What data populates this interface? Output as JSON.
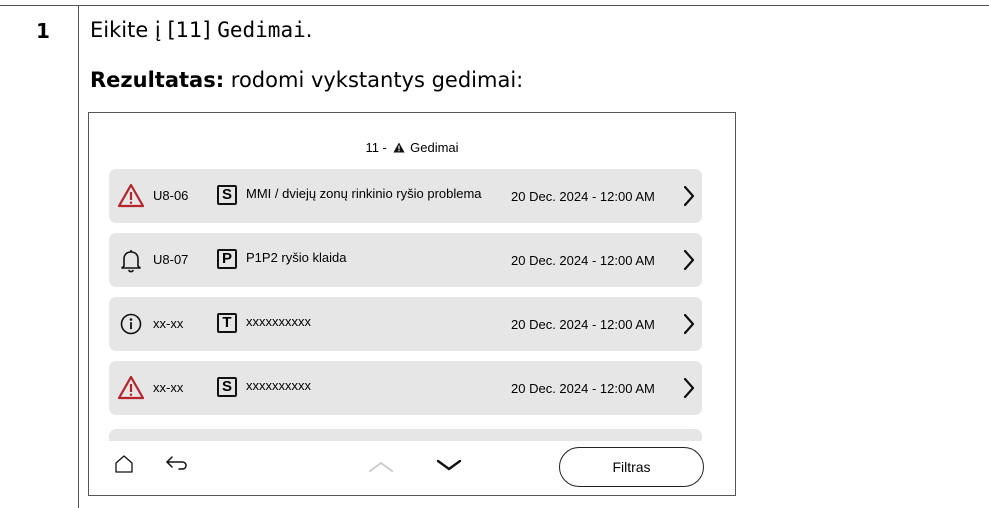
{
  "step": {
    "number": "1",
    "instruction_pre": "Eikite į [11] ",
    "instruction_code": "Gedimai",
    "instruction_post": ".",
    "result_label": "Rezultatas:",
    "result_text": " rodomi vykstantys gedimai:"
  },
  "screen": {
    "title_number": "11 -",
    "title_text": "Gedimai",
    "rows": [
      {
        "severity": "warning-icon",
        "code": "U8-06",
        "category": "S",
        "description": "MMI / dviejų zonų rinkinio ryšio problema",
        "datetime": "20 Dec. 2024 - 12:00 AM"
      },
      {
        "severity": "bell-icon",
        "code": "U8-07",
        "category": "P",
        "description": "P1P2 ryšio klaida",
        "datetime": "20 Dec. 2024 - 12:00 AM"
      },
      {
        "severity": "info-icon",
        "code": "xx-xx",
        "category": "T",
        "description": "xxxxxxxxxx",
        "datetime": "20 Dec. 2024 - 12:00 AM"
      },
      {
        "severity": "warning-icon",
        "code": "xx-xx",
        "category": "S",
        "description": "xxxxxxxxxx",
        "datetime": "20 Dec. 2024 - 12:00 AM"
      }
    ],
    "filter_label": "Filtras",
    "colors": {
      "warning": "#b5262c",
      "row_bg": "#e6e6e6",
      "disabled_arrow": "#cccccc"
    }
  }
}
